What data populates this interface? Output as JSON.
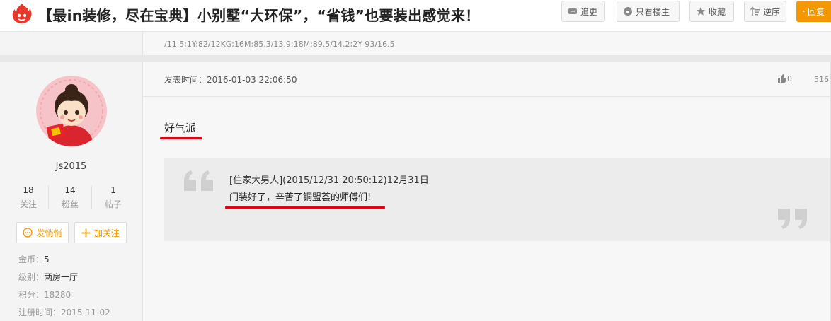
{
  "header": {
    "title": "【最in装修，尽在宝典】小别墅“大环保”，“省钱”也要装出感觉来！",
    "buttons": {
      "update": "追更",
      "only_op": "只看楼主",
      "favorite": "收藏",
      "reverse": "逆序",
      "reply": "回复"
    }
  },
  "strip": {
    "text": "/11.5;1Y:82/12KG;16M:85.3/13.9;18M:89.5/14.2;2Y 93/16.5"
  },
  "user": {
    "name": "Js2015",
    "stats": [
      {
        "value": "18",
        "label": "关注"
      },
      {
        "value": "14",
        "label": "粉丝"
      },
      {
        "value": "1",
        "label": "帖子"
      }
    ],
    "message_button": "发悄悄",
    "follow_button": "加关注",
    "coins_label": "金币：",
    "coins_value": "5",
    "level_label": "级别：",
    "level_value": "两房一厅",
    "points_label": "积分：",
    "points_value": "18280",
    "reg_label": "注册时间：",
    "reg_value": "2015-11-02"
  },
  "post": {
    "time": "发表时间：2016-01-03 22:06:50",
    "likes": "0",
    "views": "516",
    "content": "好气派",
    "quote_source": "[住家大男人](2015/12/31 20:50:12)12月31日",
    "quote_text": "门装好了，辛苦了铜盟荟的师傅们!"
  },
  "colors": {
    "accent": "#f39800",
    "underline": "#e60012"
  }
}
